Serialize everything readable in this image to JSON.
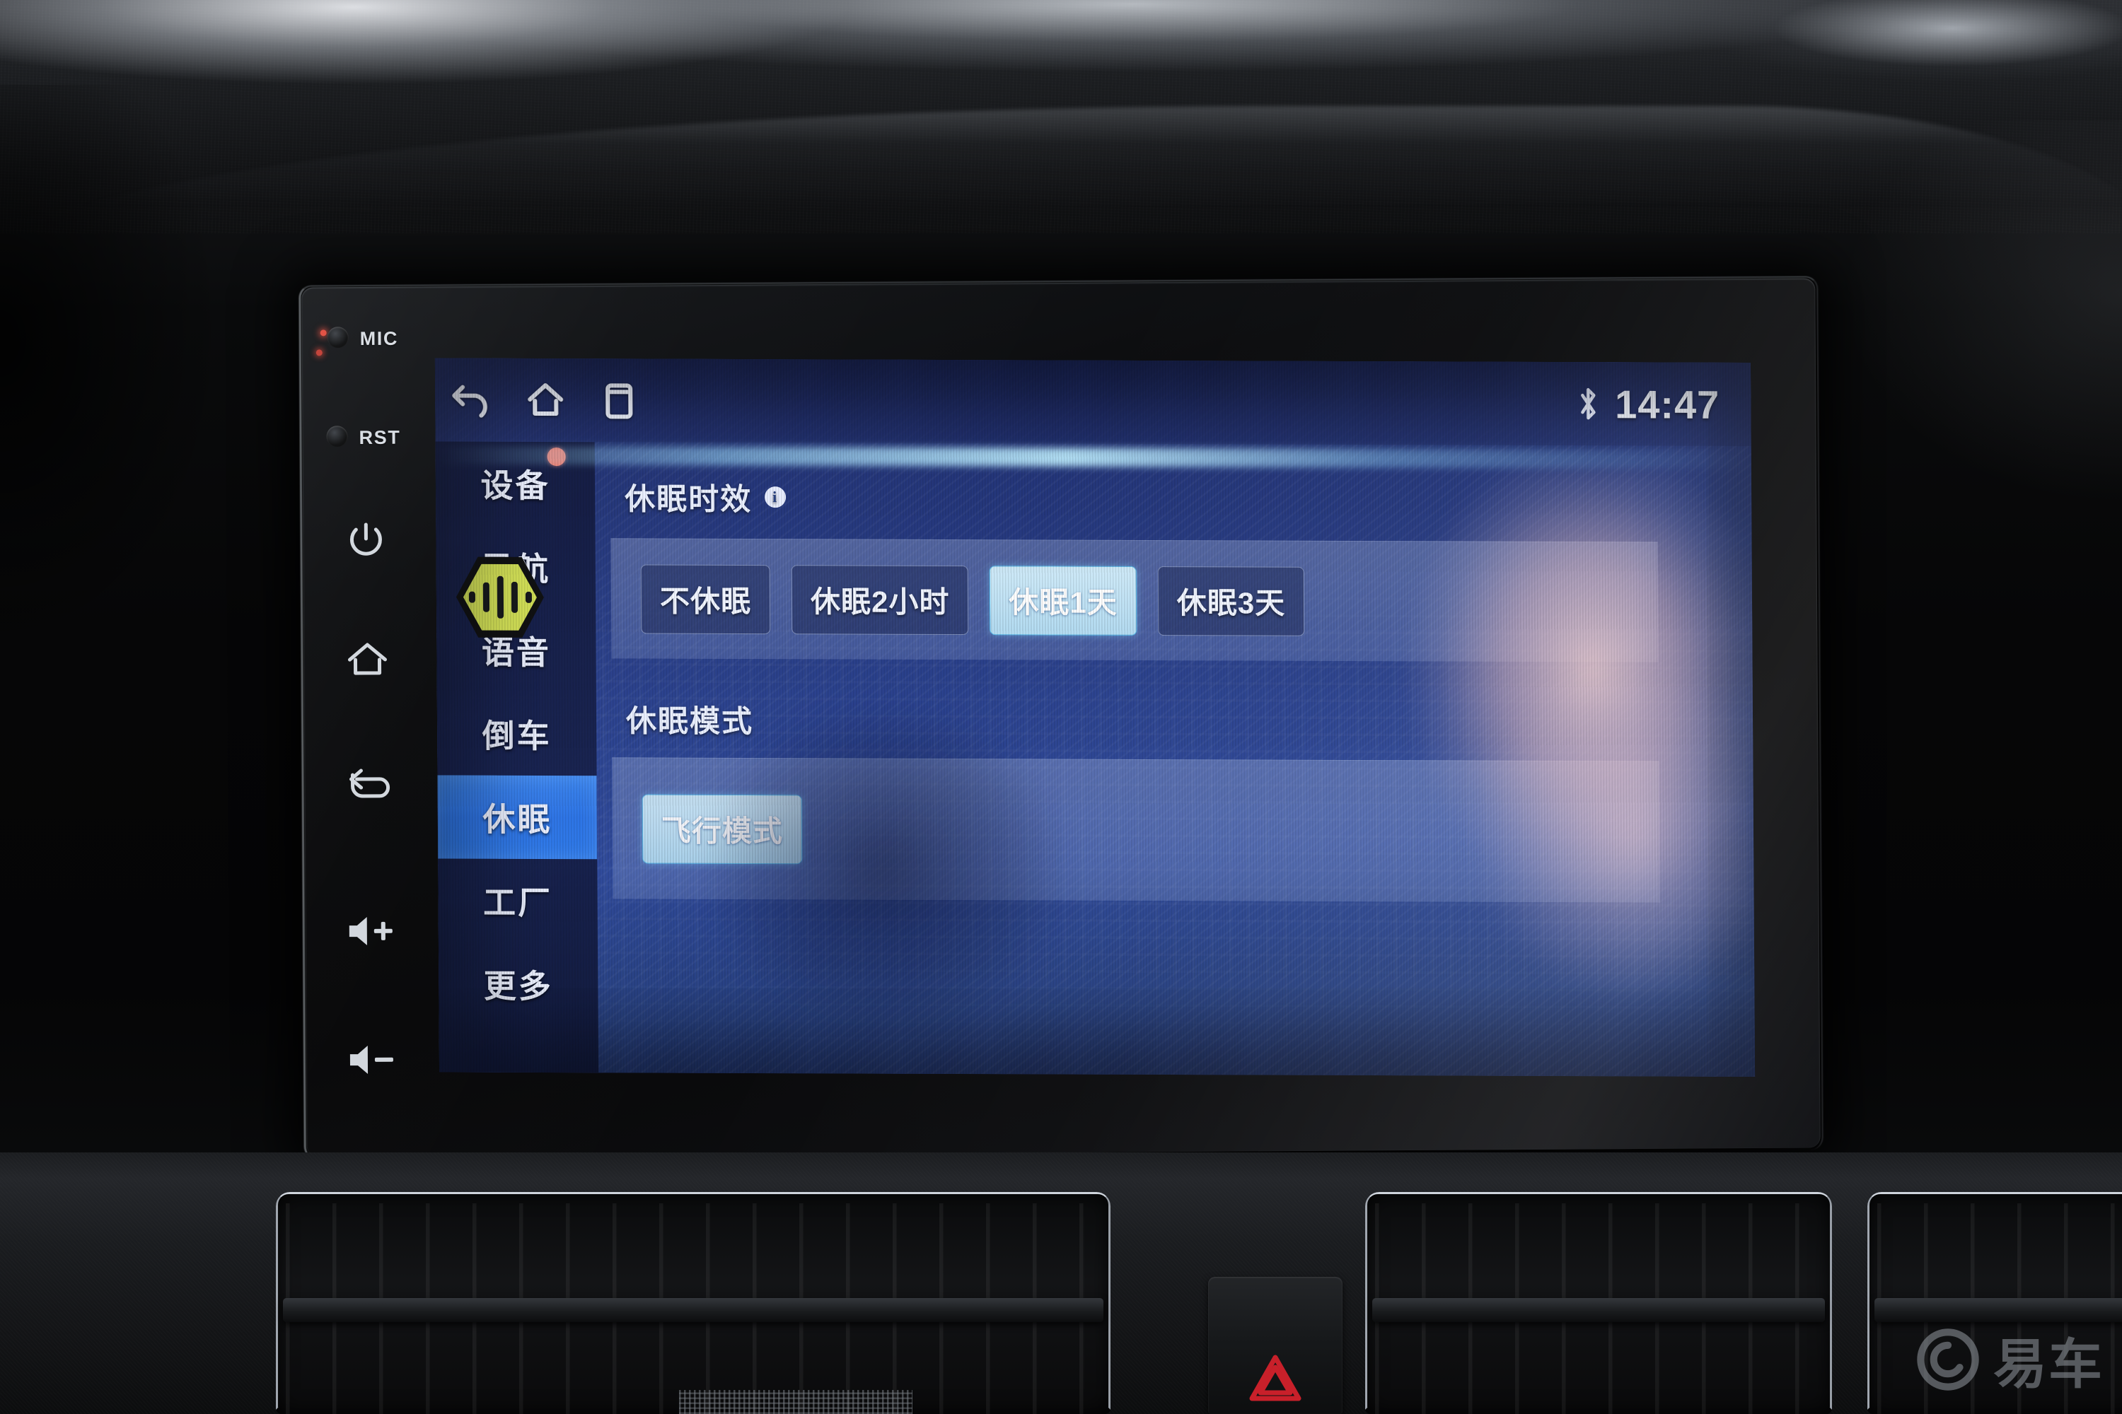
{
  "statusbar": {
    "back_icon": "back-arrow-icon",
    "home_icon": "home-icon",
    "recents_icon": "recents-icon",
    "bluetooth_icon": "bluetooth-icon",
    "clock": "14:47"
  },
  "sidebar": {
    "items": [
      {
        "label": "设备",
        "active": false
      },
      {
        "label": "导航",
        "active": false
      },
      {
        "label": "语音",
        "active": false
      },
      {
        "label": "倒车",
        "active": false
      },
      {
        "label": "休眠",
        "active": true
      },
      {
        "label": "工厂",
        "active": false
      },
      {
        "label": "更多",
        "active": false
      }
    ],
    "notification_dot_color": "#ee7b6d",
    "voice_icon": {
      "name": "voice-assistant-hexagon-icon",
      "color": "#d2e055"
    }
  },
  "content": {
    "sections": [
      {
        "title": "休眠时效",
        "has_info_icon": true,
        "info_icon_label": "i",
        "options": [
          {
            "label": "不休眠",
            "selected": false
          },
          {
            "label": "休眠2小时",
            "selected": false
          },
          {
            "label": "休眠1天",
            "selected": true
          },
          {
            "label": "休眠3天",
            "selected": false
          }
        ]
      },
      {
        "title": "休眠模式",
        "has_info_icon": false,
        "options": [
          {
            "label": "飞行模式",
            "selected": true
          }
        ]
      }
    ]
  },
  "bezel": {
    "buttons": [
      {
        "label": "MIC",
        "type": "hole",
        "icon": "microphone-hole-icon"
      },
      {
        "label": "RST",
        "type": "hole",
        "icon": "reset-hole-icon"
      },
      {
        "label": "",
        "type": "icon",
        "icon": "power-icon"
      },
      {
        "label": "",
        "type": "icon",
        "icon": "home-icon"
      },
      {
        "label": "",
        "type": "icon",
        "icon": "back-icon"
      },
      {
        "label": "",
        "type": "icon",
        "icon": "volume-up-icon"
      },
      {
        "label": "",
        "type": "icon",
        "icon": "volume-down-icon"
      }
    ]
  },
  "console": {
    "hazard_icon": "hazard-triangle-icon",
    "hazard_color": "#c8202a"
  },
  "watermark": {
    "text": "易车",
    "logo_icon": "yiche-circle-logo-icon"
  },
  "colors": {
    "accent_blue": "#2f7ae9",
    "selected_chip": "#bfe2f5",
    "screen_bg": "#2b428e",
    "text_light": "#eaf0ff"
  }
}
